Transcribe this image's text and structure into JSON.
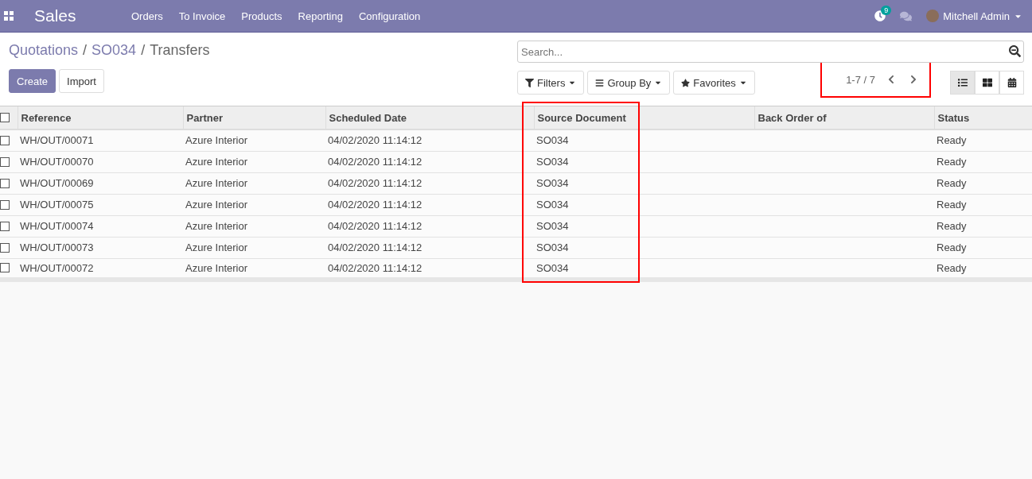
{
  "navbar": {
    "app_name": "Sales",
    "menu": [
      "Orders",
      "To Invoice",
      "Products",
      "Reporting",
      "Configuration"
    ],
    "activity_count": "9",
    "user_name": "Mitchell Admin"
  },
  "breadcrumbs": [
    {
      "label": "Quotations",
      "link": true
    },
    {
      "separator": "/",
      "label": "SO034",
      "link": true
    },
    {
      "separator": "/",
      "label": "Transfers",
      "link": false
    }
  ],
  "buttons": [
    {
      "label": "Create",
      "kind": "primary"
    },
    {
      "label": "Import",
      "kind": "secondary"
    }
  ],
  "search": {
    "placeholder": "Search..."
  },
  "search_options": [
    {
      "label": "Filters",
      "kind": "filter"
    },
    {
      "label": "Group By",
      "kind": "group"
    },
    {
      "label": "Favorites",
      "kind": "star"
    }
  ],
  "pager": {
    "text": "1-7 / 7",
    "highlighted": true
  },
  "views": [
    {
      "kind": "list",
      "selected": true
    },
    {
      "kind": "kanban",
      "selected": false
    },
    {
      "kind": "calendar",
      "selected": false
    }
  ],
  "table": {
    "select_all_checked": false,
    "columns": [
      {
        "label": "Reference",
        "highlighted": false
      },
      {
        "label": "Partner",
        "highlighted": false
      },
      {
        "label": "Scheduled Date",
        "highlighted": false
      },
      {
        "label": "Source Document",
        "highlighted": true
      },
      {
        "label": "Back Order of",
        "highlighted": false
      },
      {
        "label": "Status",
        "highlighted": false
      }
    ],
    "rows": [
      {
        "checked": false,
        "cells": [
          "WH/OUT/00071",
          "Azure Interior",
          "04/02/2020 11:14:12",
          "SO034",
          "",
          "Ready"
        ]
      },
      {
        "checked": false,
        "cells": [
          "WH/OUT/00070",
          "Azure Interior",
          "04/02/2020 11:14:12",
          "SO034",
          "",
          "Ready"
        ]
      },
      {
        "checked": false,
        "cells": [
          "WH/OUT/00069",
          "Azure Interior",
          "04/02/2020 11:14:12",
          "SO034",
          "",
          "Ready"
        ]
      },
      {
        "checked": false,
        "cells": [
          "WH/OUT/00075",
          "Azure Interior",
          "04/02/2020 11:14:12",
          "SO034",
          "",
          "Ready"
        ]
      },
      {
        "checked": false,
        "cells": [
          "WH/OUT/00074",
          "Azure Interior",
          "04/02/2020 11:14:12",
          "SO034",
          "",
          "Ready"
        ]
      },
      {
        "checked": false,
        "cells": [
          "WH/OUT/00073",
          "Azure Interior",
          "04/02/2020 11:14:12",
          "SO034",
          "",
          "Ready"
        ]
      },
      {
        "checked": false,
        "cells": [
          "WH/OUT/00072",
          "Azure Interior",
          "04/02/2020 11:14:12",
          "SO034",
          "",
          "Ready"
        ]
      }
    ]
  }
}
